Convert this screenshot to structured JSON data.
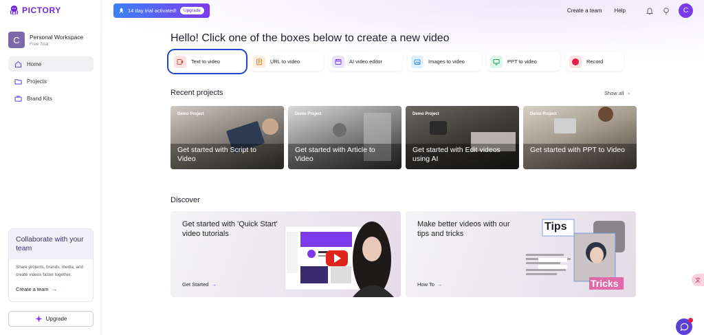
{
  "brand": {
    "name": "PICTORY",
    "color": "#6d28d9"
  },
  "workspace": {
    "initial": "C",
    "name": "Personal Workspace",
    "plan": "Free Trial"
  },
  "nav": [
    {
      "label": "Home",
      "icon": "home-icon",
      "active": true
    },
    {
      "label": "Projects",
      "icon": "folder-icon",
      "active": false
    },
    {
      "label": "Brand Kits",
      "icon": "briefcase-icon",
      "active": false
    }
  ],
  "collab": {
    "title": "Collaborate with your team",
    "text": "Share projects, brands, media, and create videos faster together.",
    "link": "Create a team"
  },
  "upgrade_button": "Upgrade",
  "header": {
    "trial_text": "14 day trial activated!",
    "trial_button": "Upgrade",
    "create_team": "Create a team",
    "help": "Help",
    "avatar_initial": "C"
  },
  "hero": {
    "title": "Hello! Click one of the boxes below to create a new video"
  },
  "actions": [
    {
      "label": "Text to video",
      "icon": "text-video-icon",
      "bg": "#fde2e2",
      "fg": "#e24b4b",
      "selected": true
    },
    {
      "label": "URL to video",
      "icon": "url-doc-icon",
      "bg": "#fdf0e0",
      "fg": "#d9822b",
      "selected": false
    },
    {
      "label": "AI video editor",
      "icon": "ai-editor-icon",
      "bg": "#ece4fb",
      "fg": "#7c3aed",
      "selected": false
    },
    {
      "label": "Images to video",
      "icon": "images-icon",
      "bg": "#dff0fb",
      "fg": "#2b8fd9",
      "selected": false
    },
    {
      "label": "PPT to video",
      "icon": "ppt-icon",
      "bg": "#dff6ea",
      "fg": "#22a060",
      "selected": false
    },
    {
      "label": "Record",
      "icon": "record-icon",
      "bg": "#fde2e4",
      "fg": "#e11d48",
      "selected": false
    }
  ],
  "recent": {
    "title": "Recent projects",
    "show_all": "Show all",
    "items": [
      {
        "tag": "Demo Project",
        "caption": "Get started with Script to Video"
      },
      {
        "tag": "Demo Project",
        "caption": "Get started with Article to Video"
      },
      {
        "tag": "Demo Project",
        "caption": "Get started with Edit videos using AI"
      },
      {
        "tag": "Demo Project",
        "caption": "Get started with PPT to Video"
      }
    ]
  },
  "discover": {
    "title": "Discover",
    "items": [
      {
        "title": "Get started with 'Quick Start' video tutorials",
        "link": "Get Started",
        "thumb_brand": "Pictory"
      },
      {
        "title": "Make better videos with our tips and tricks",
        "link": "How To",
        "thumb_top": "Tips",
        "thumb_bottom": "Tricks"
      }
    ]
  }
}
